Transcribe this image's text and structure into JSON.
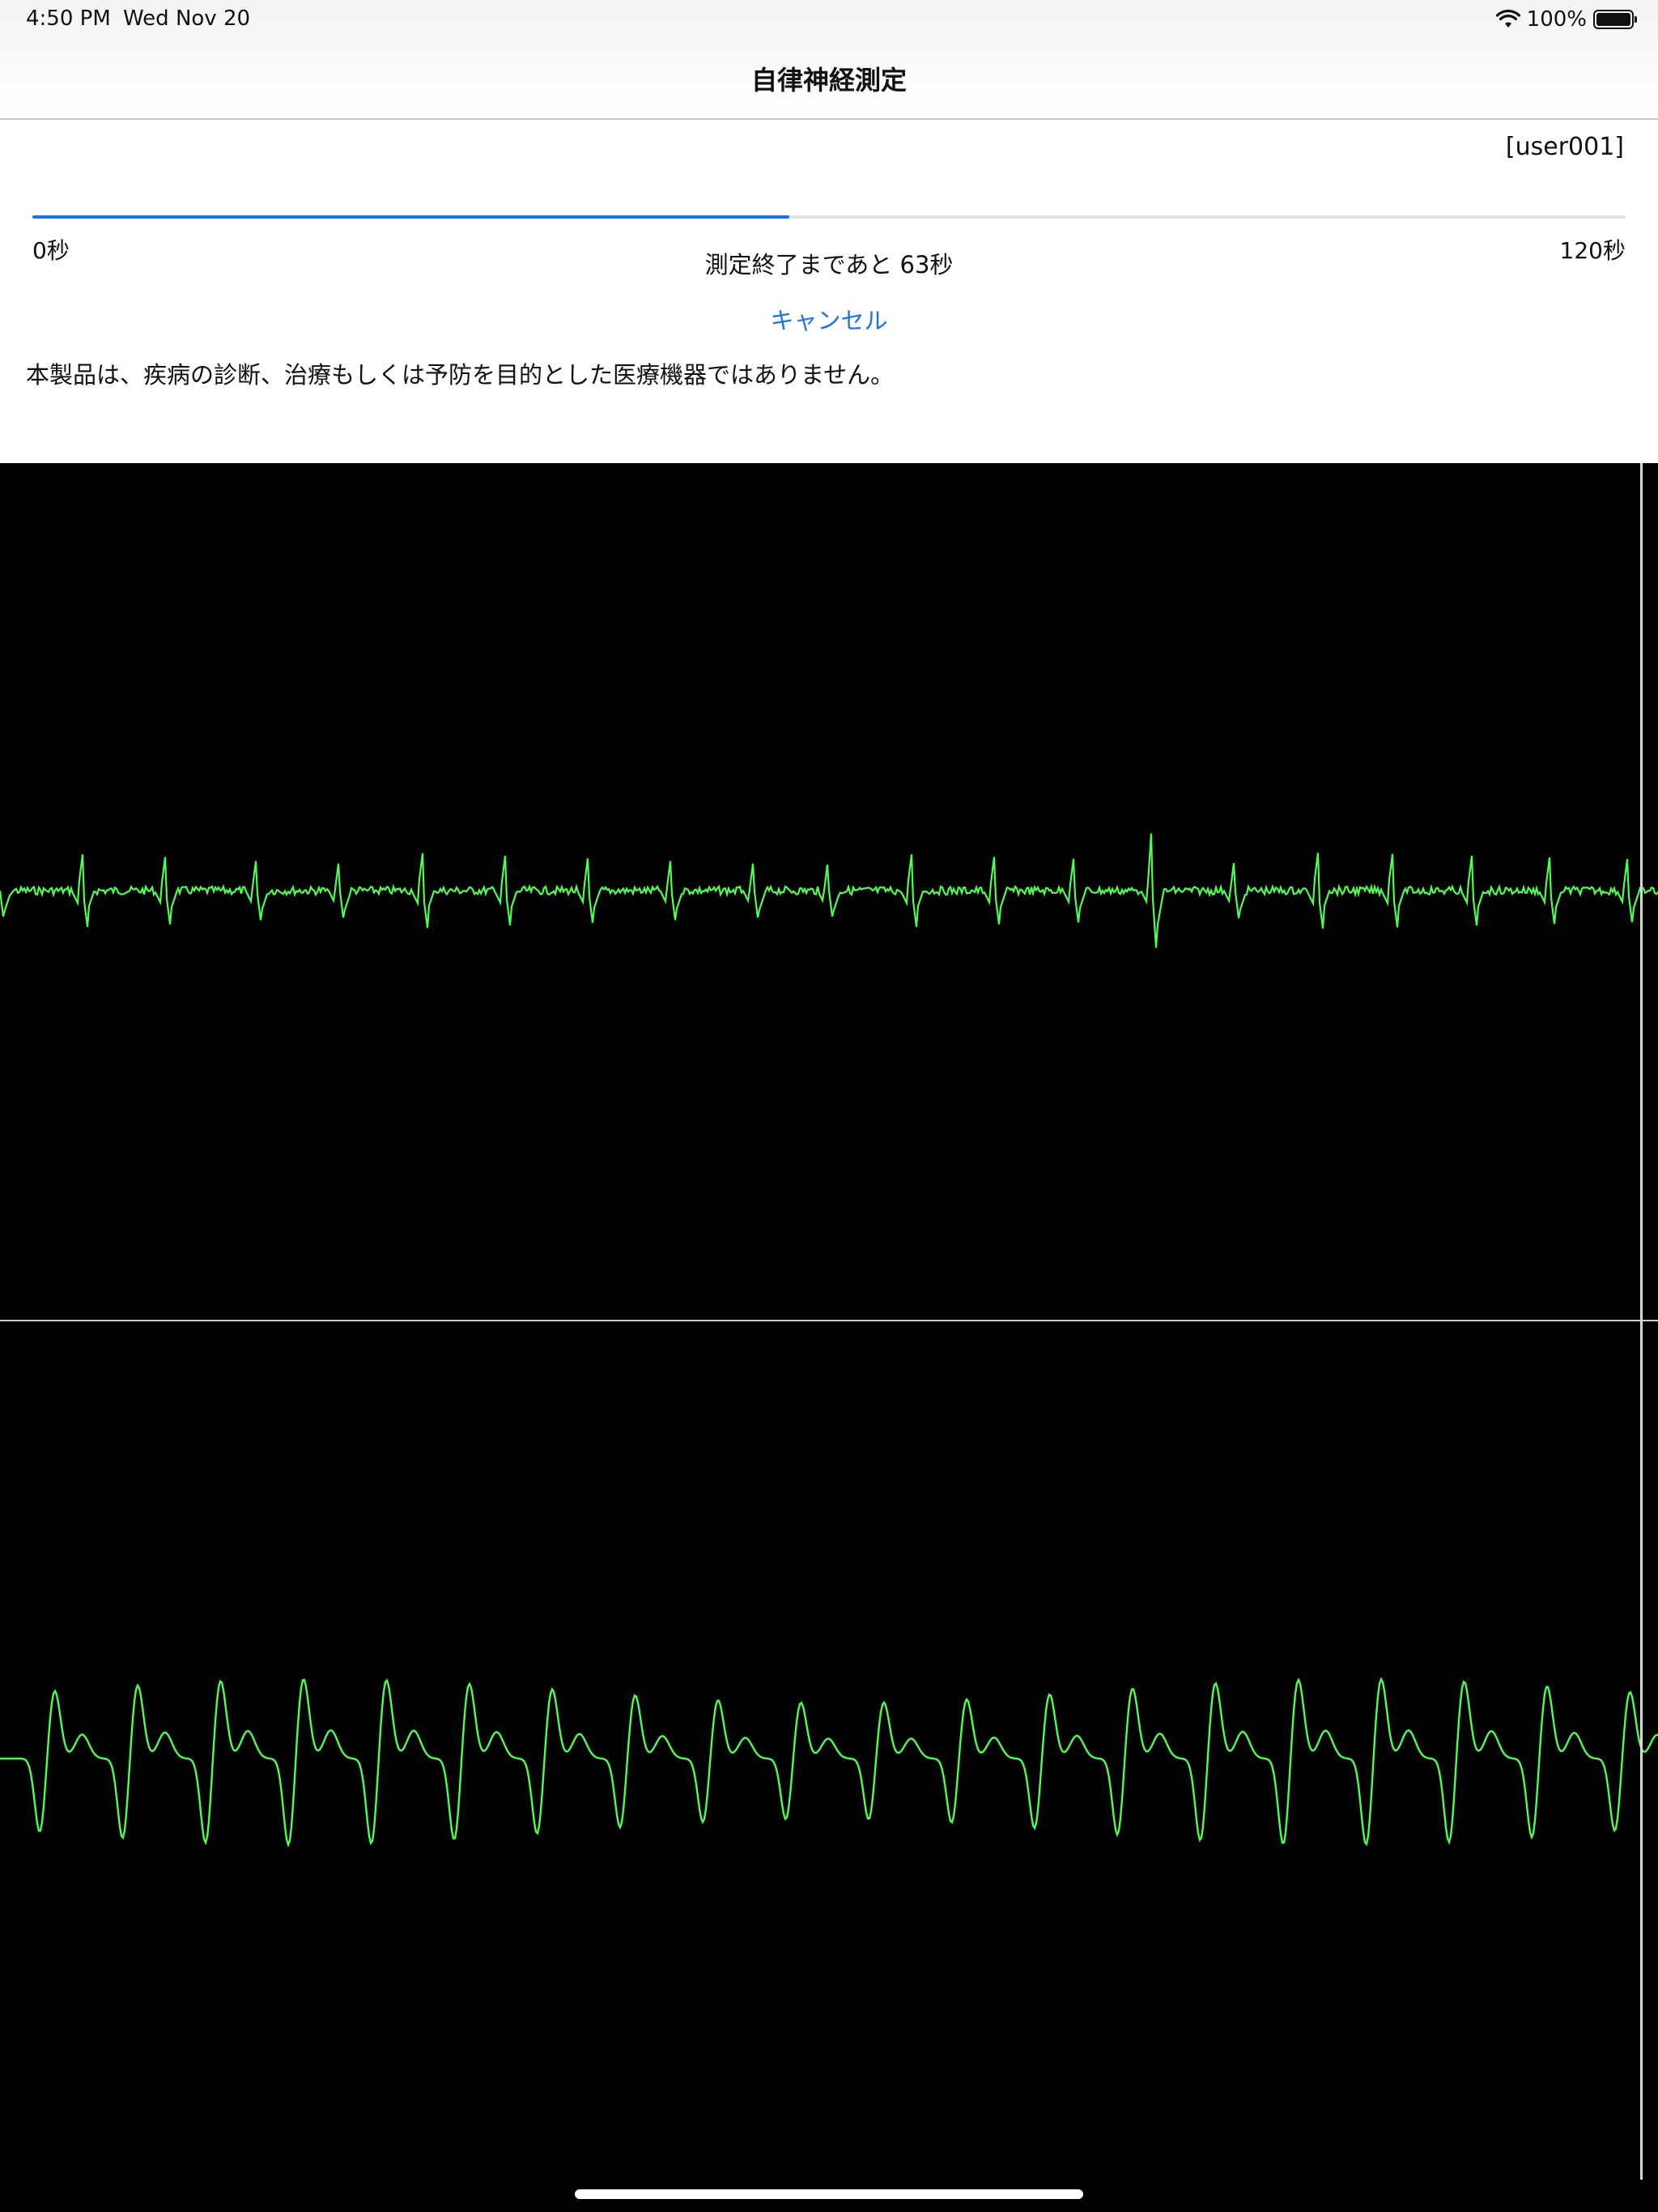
{
  "status_bar": {
    "time": "4:50 PM",
    "date": "Wed Nov 20",
    "battery_percent": "100%",
    "icons": [
      "wifi-icon",
      "battery-icon"
    ]
  },
  "nav": {
    "title": "自律神経測定"
  },
  "measurement": {
    "user_id": "[user001]",
    "progress_min_label": "0秒",
    "progress_max_label": "120秒",
    "progress_fraction": 0.475,
    "remaining_text": "測定終了まであと 63秒",
    "cancel_label": "キャンセル",
    "disclaimer": "本製品は、疾病の診断、治療もしくは予防を目的とした医療機器ではありません。"
  },
  "colors": {
    "accent": "#1a73e8",
    "waveform": "#4cff4c",
    "monitor_background": "#000000"
  },
  "waveforms": {
    "ecg": {
      "beats": [
        0.0,
        0.05,
        0.1,
        0.155,
        0.205,
        0.255,
        0.305,
        0.355,
        0.405,
        0.455,
        0.5,
        0.55,
        0.6,
        0.648,
        0.695,
        0.745,
        0.795,
        0.84,
        0.888,
        0.935,
        0.982
      ]
    },
    "pulse": {
      "beats": [
        0.03,
        0.08,
        0.13,
        0.18,
        0.23,
        0.28,
        0.33,
        0.38,
        0.43,
        0.48,
        0.53,
        0.58,
        0.63,
        0.68,
        0.73,
        0.78,
        0.83,
        0.88,
        0.93,
        0.98
      ]
    }
  }
}
